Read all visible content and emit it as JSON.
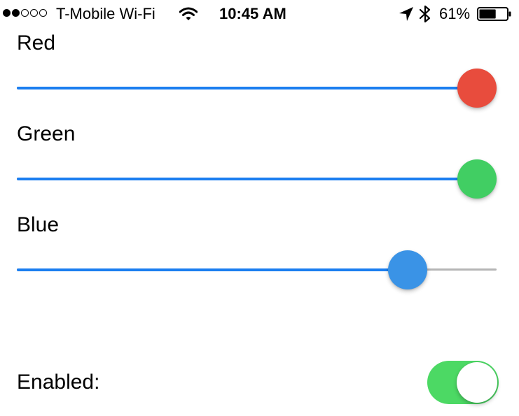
{
  "status_bar": {
    "signal_dots": [
      true,
      true,
      false,
      false,
      false
    ],
    "carrier": "T-Mobile Wi-Fi",
    "wifi_icon": "wifi-icon",
    "time": "10:45 AM",
    "location_icon": "location-arrow-icon",
    "bluetooth_icon": "bluetooth-icon",
    "battery_percent": "61%",
    "battery_level": 0.61
  },
  "sliders": [
    {
      "label": "Red",
      "value": 1.0,
      "thumb_color": "#e84c3d"
    },
    {
      "label": "Green",
      "value": 1.0,
      "thumb_color": "#41ce63"
    },
    {
      "label": "Blue",
      "value": 0.85,
      "thumb_color": "#3a93e6"
    }
  ],
  "slider_colors": {
    "track_fill": "#1b7ef0",
    "track_empty": "#b5b5b5"
  },
  "toggle": {
    "label": "Enabled:",
    "on": true,
    "on_color": "#4cd964"
  }
}
